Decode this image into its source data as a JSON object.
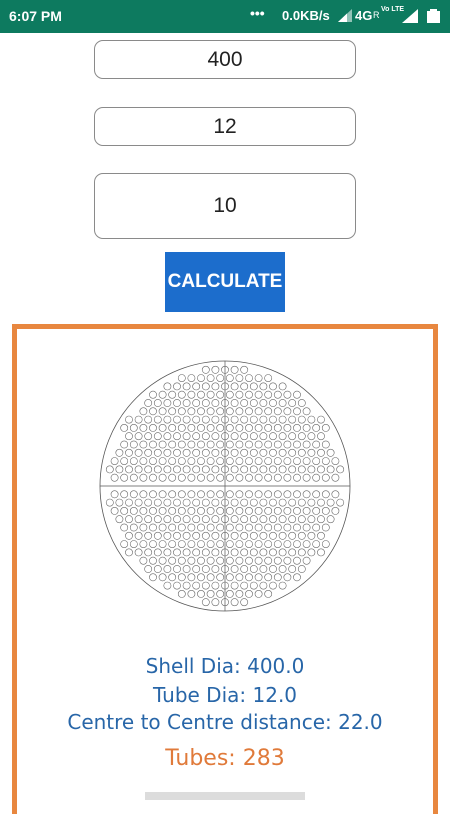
{
  "status_bar": {
    "time": "6:07 PM",
    "dots": "•••",
    "speed": "0.0KB/s",
    "network": "4G",
    "roaming": "R",
    "volte": "Vo LTE"
  },
  "inputs": {
    "shell_dia_value": "400",
    "tube_dia_value": "12",
    "pitch_value": "10"
  },
  "calculate_label": "CALCULATE",
  "results": {
    "shell_dia": "Shell Dia: 400.0",
    "tube_dia": "Tube Dia: 12.0",
    "centre_distance": "Centre to Centre distance: 22.0",
    "tubes": "Tubes: 283"
  },
  "colors": {
    "status_bar": "#0d7a5f",
    "button": "#1c6dcc",
    "panel_border": "#e8873f",
    "result_text": "#2866a8",
    "tubes_text": "#e07a3a"
  }
}
